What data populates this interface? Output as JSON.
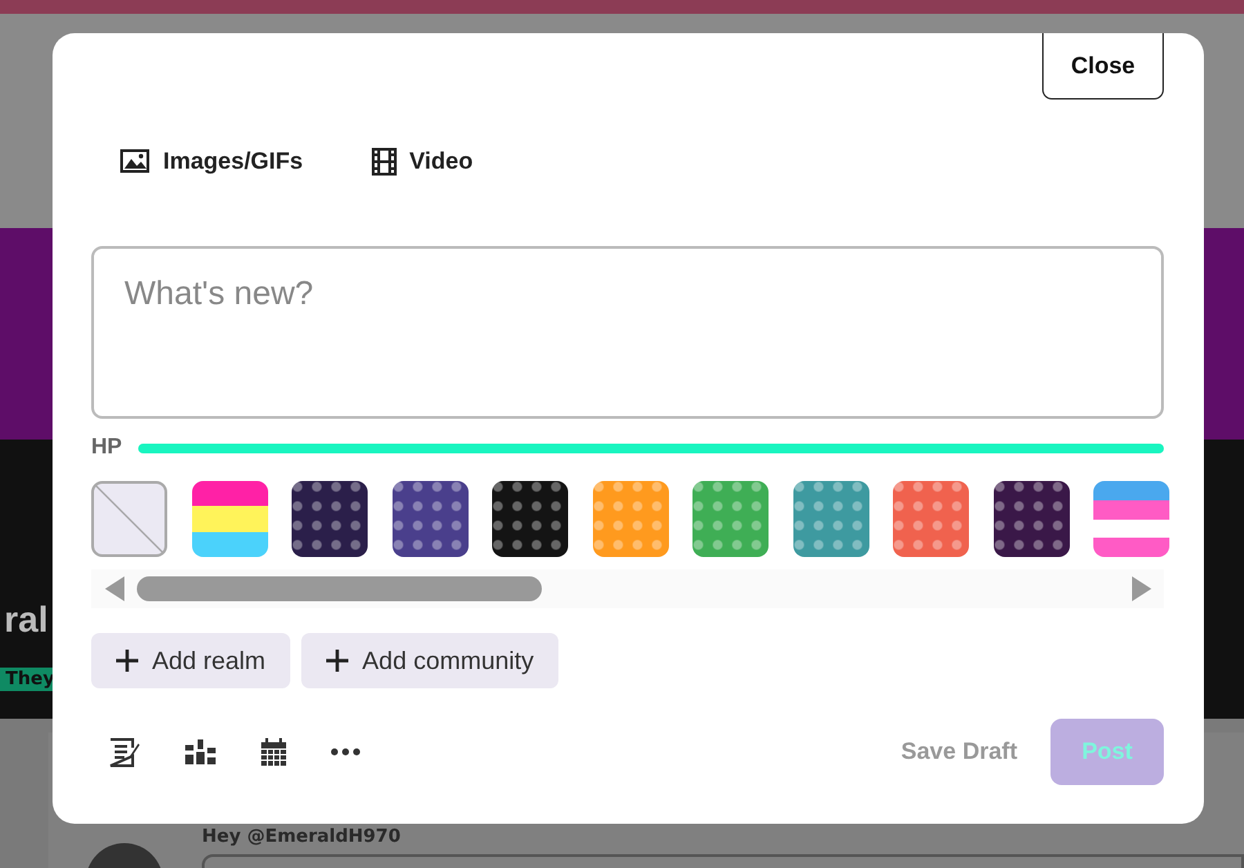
{
  "background": {
    "name_fragment": "ral",
    "tag": "They",
    "greeting": "Hey @EmeraldH970"
  },
  "modal": {
    "close_label": "Close",
    "media_tabs": [
      {
        "kind": "image",
        "label": "Images/GIFs"
      },
      {
        "kind": "video",
        "label": "Video"
      }
    ],
    "composer": {
      "placeholder": "What's new?"
    },
    "hp": {
      "label": "HP",
      "level": 1.0
    },
    "swatches": [
      {
        "kind": "none"
      },
      {
        "kind": "flag",
        "stripes": [
          {
            "color": "#ff21a6"
          },
          {
            "color": "#fff35a"
          },
          {
            "color": "#4bd2fb"
          }
        ]
      },
      {
        "kind": "pattern",
        "color": "#2b1f4a"
      },
      {
        "kind": "pattern",
        "color": "#4a3f8c"
      },
      {
        "kind": "pattern",
        "color": "#141414"
      },
      {
        "kind": "pattern",
        "color": "#ff9a1e"
      },
      {
        "kind": "pattern",
        "color": "#3fae55"
      },
      {
        "kind": "pattern",
        "color": "#3e9aa0"
      },
      {
        "kind": "pattern",
        "color": "#f0624e"
      },
      {
        "kind": "pattern",
        "color": "#3a1848"
      },
      {
        "kind": "flag",
        "stripes": [
          {
            "color": "#4aa8ee"
          },
          {
            "color": "#ff5bc4"
          },
          {
            "color": "#ffffff"
          },
          {
            "color": "#ff5bc5"
          }
        ]
      }
    ],
    "add_buttons": [
      "Add realm",
      "Add community"
    ],
    "tools": [
      {
        "kind": "note"
      },
      {
        "kind": "ranking"
      },
      {
        "kind": "calendar"
      },
      {
        "kind": "more"
      }
    ],
    "save_draft": "Save Draft",
    "post": {
      "label": "Post",
      "disabled": true
    }
  }
}
